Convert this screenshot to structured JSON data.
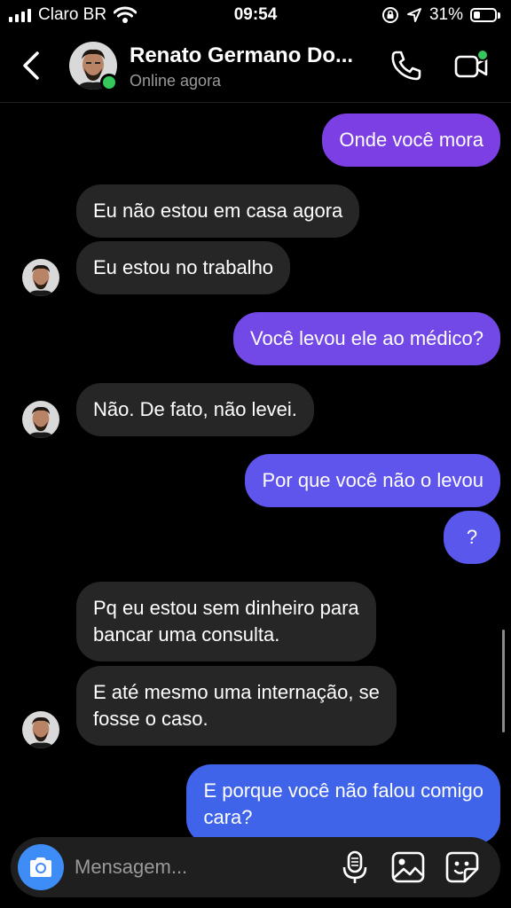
{
  "status_bar": {
    "carrier": "Claro BR",
    "time": "09:54",
    "battery": "31%",
    "battery_level": 0.31
  },
  "header": {
    "contact_name": "Renato Germano Do...",
    "contact_status": "Online agora",
    "online_color": "#35c759"
  },
  "messages": [
    {
      "direction": "out",
      "text": "Onde você mora"
    },
    {
      "direction": "in",
      "text": "Eu não estou em casa agora"
    },
    {
      "direction": "in",
      "text": "Eu estou no trabalho"
    },
    {
      "direction": "out",
      "text": "Você levou ele ao médico?"
    },
    {
      "direction": "in",
      "text": "Não. De fato, não levei."
    },
    {
      "direction": "out",
      "text": "Por que você não o levou"
    },
    {
      "direction": "out",
      "text": "?"
    },
    {
      "direction": "in",
      "line1": "Pq eu estou sem dinheiro para",
      "line2": "bancar uma consulta."
    },
    {
      "direction": "in",
      "line1": "E até mesmo uma internação, se",
      "line2": "fosse o caso."
    },
    {
      "direction": "out",
      "line1": "E porque você não falou comigo",
      "line2": "cara?"
    }
  ],
  "colors": {
    "incoming_bubble": "#262626",
    "outgoing_purple": "#7b3fe4",
    "outgoing_indigo": "#5f55ec",
    "outgoing_blue": "#3f64ea",
    "camera_button": "#3e8cf5"
  },
  "composer": {
    "placeholder": "Mensagem..."
  }
}
